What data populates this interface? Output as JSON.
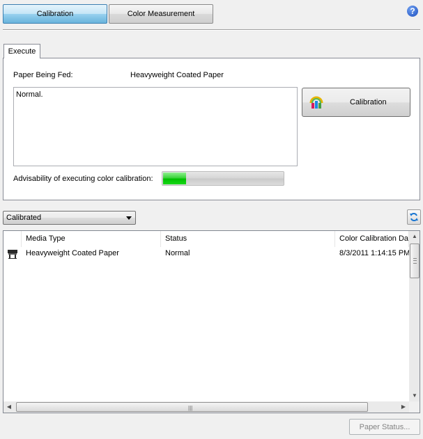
{
  "toolbar": {
    "modes": [
      {
        "label": "Calibration",
        "active": true
      },
      {
        "label": "Color Measurement",
        "active": false
      }
    ],
    "help_glyph": "?",
    "help_icon": "help-icon"
  },
  "execute_tab": {
    "tab_label": "Execute",
    "paper_label": "Paper Being Fed:",
    "paper_value": "Heavyweight Coated Paper",
    "message": "Normal.",
    "calibration_button": "Calibration",
    "calibration_icon": "color-calibration-icon",
    "advisability_label": "Advisability of executing color calibration:",
    "advisability_level_fraction": 0.2
  },
  "filter": {
    "selected": "Calibrated",
    "refresh_icon": "refresh-icon"
  },
  "media_list": {
    "columns": [
      "Media Type",
      "Status",
      "Color Calibration Date"
    ],
    "rows": [
      {
        "icon": "printer-icon",
        "media_type": "Heavyweight Coated Paper",
        "status": "Normal",
        "date": "8/3/2011 1:14:15 PM"
      }
    ]
  },
  "footer": {
    "paper_status_button": "Paper Status...",
    "paper_status_enabled": false
  },
  "colors": {
    "active_tab": "#98d1ef",
    "progress_fill": "#00c000",
    "help_blue": "#1c4fbf"
  }
}
